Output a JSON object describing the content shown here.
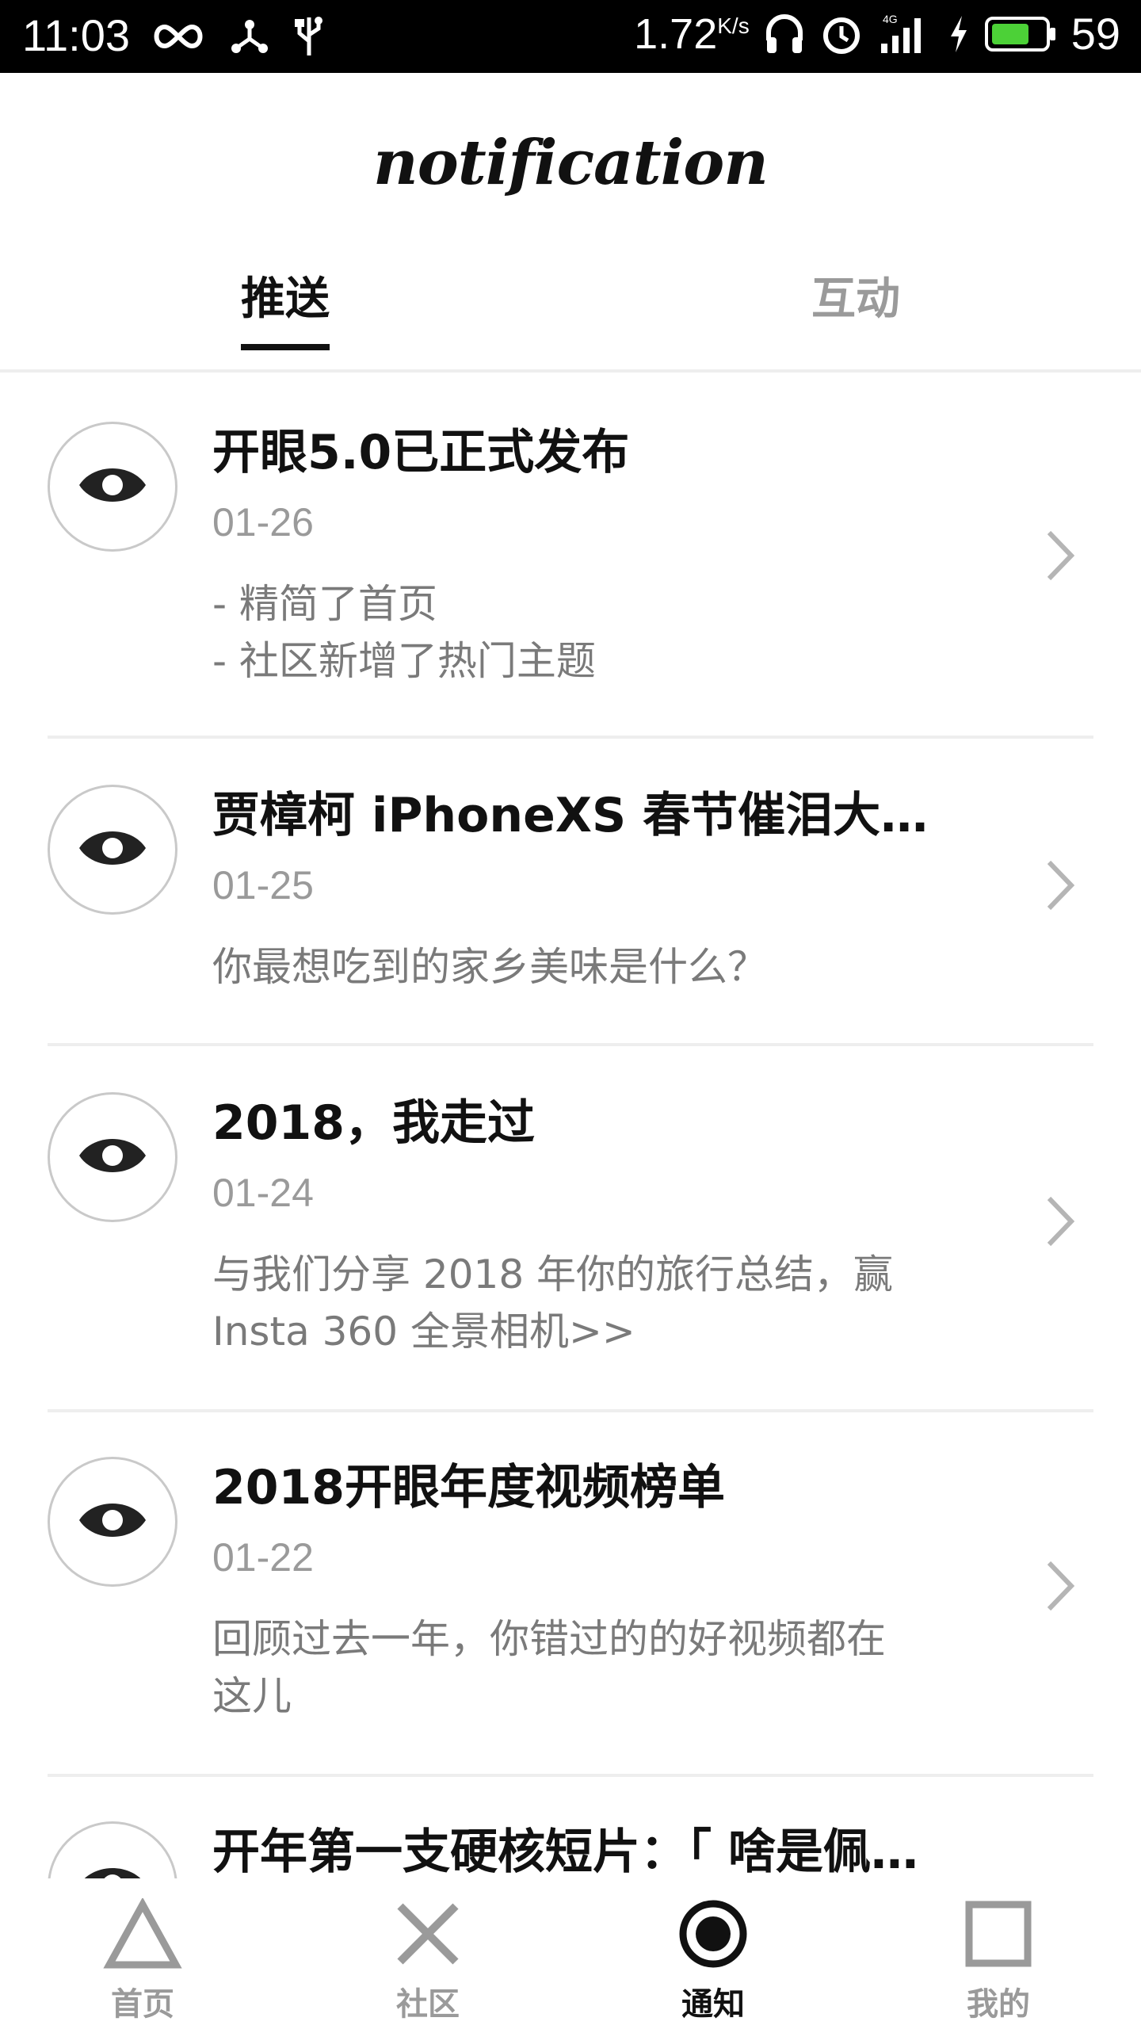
{
  "status_bar": {
    "time": "11:03",
    "speed": "1.72",
    "speed_unit": "K/s",
    "battery": "59",
    "left_icons": [
      "infinity-icon",
      "share-icon",
      "usb-icon"
    ],
    "right_icons": [
      "headphones-icon",
      "alarm-icon",
      "signal-4g-icon",
      "charging-icon",
      "battery-icon"
    ],
    "battery_color": "#4cd137"
  },
  "header": {
    "title": "notification"
  },
  "tabs": [
    {
      "label": "推送",
      "active": true
    },
    {
      "label": "互动",
      "active": false
    }
  ],
  "notifications": [
    {
      "title": "开眼5.0已正式发布",
      "date": "01-26",
      "body": [
        "- 精简了首页",
        "- 社区新增了热门主题"
      ],
      "icon": "eye-icon"
    },
    {
      "title": "贾樟柯  iPhoneXS 春节催泪大…",
      "date": "01-25",
      "body": [
        "你最想吃到的家乡美味是什么？"
      ],
      "icon": "eye-icon"
    },
    {
      "title": "2018，我走过",
      "date": "01-24",
      "body": [
        "与我们分享 2018 年你的旅行总结，赢",
        "Insta 360 全景相机>>"
      ],
      "icon": "eye-icon"
    },
    {
      "title": "2018开眼年度视频榜单",
      "date": "01-22",
      "body": [
        "回顾过去一年，你错过的的好视频都在",
        "这儿"
      ],
      "icon": "eye-icon"
    },
    {
      "title": "开年第一支硬核短片：「 啥是佩…",
      "date": "",
      "body": [],
      "icon": "eye-icon"
    }
  ],
  "bottom_nav": [
    {
      "label": "首页",
      "icon": "triangle-icon",
      "active": false
    },
    {
      "label": "社区",
      "icon": "cross-icon",
      "active": false
    },
    {
      "label": "通知",
      "icon": "circle-dot-icon",
      "active": true
    },
    {
      "label": "我的",
      "icon": "square-icon",
      "active": false
    }
  ]
}
